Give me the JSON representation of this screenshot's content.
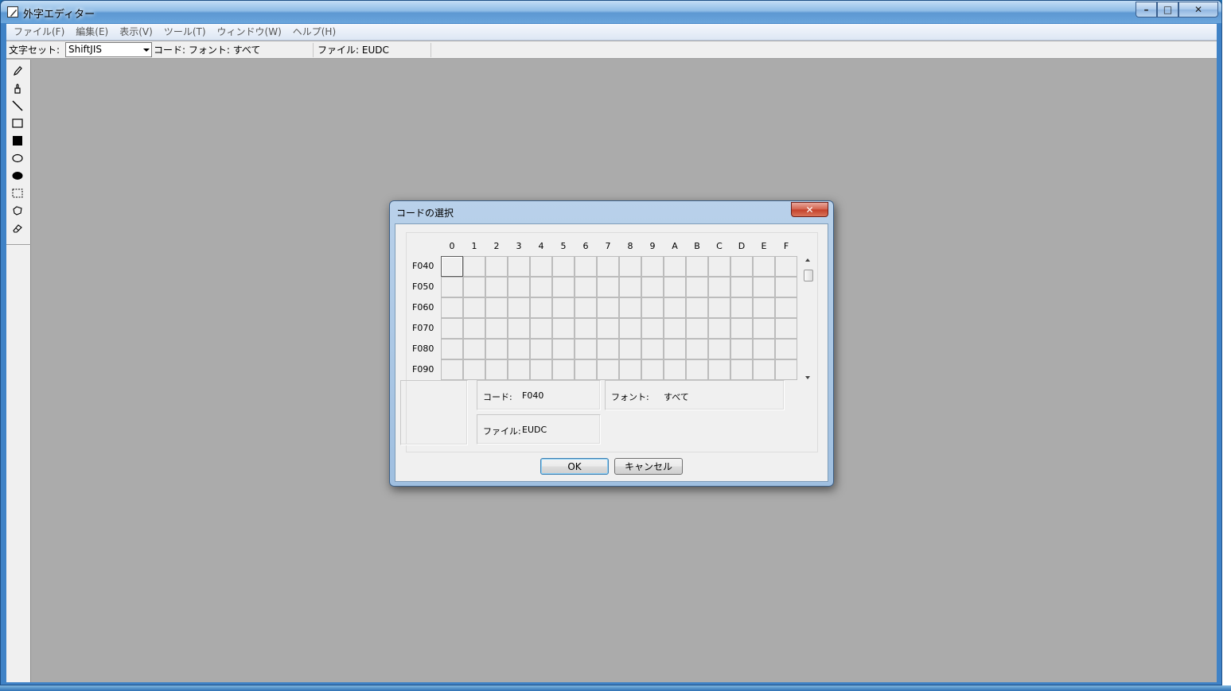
{
  "window": {
    "title": "外字エディター",
    "buttons": {
      "minimize": "–",
      "maximize": "□",
      "close": "✕"
    }
  },
  "menu": {
    "items": [
      {
        "label": "ファイル(F)"
      },
      {
        "label": "編集(E)"
      },
      {
        "label": "表示(V)"
      },
      {
        "label": "ツール(T)"
      },
      {
        "label": "ウィンドウ(W)"
      },
      {
        "label": "ヘルプ(H)"
      }
    ]
  },
  "statusbar": {
    "charset_label": "文字セット:",
    "charset_value": "ShiftJIS",
    "code_status": "コード:  フォント: すべて",
    "file_status": "ファイル: EUDC"
  },
  "toolbox": {
    "tools": [
      "pencil-icon",
      "brush-icon",
      "line-icon",
      "hollow-rectangle-icon",
      "filled-rectangle-icon",
      "hollow-ellipse-icon",
      "filled-ellipse-icon",
      "rectangular-selection-icon",
      "freeform-selection-icon",
      "eraser-icon"
    ]
  },
  "dialog": {
    "title": "コードの選択",
    "close": "✕",
    "columns": [
      "0",
      "1",
      "2",
      "3",
      "4",
      "5",
      "6",
      "7",
      "8",
      "9",
      "A",
      "B",
      "C",
      "D",
      "E",
      "F"
    ],
    "rows": [
      "F040",
      "F050",
      "F060",
      "F070",
      "F080",
      "F090"
    ],
    "selected_code": "F040",
    "code_label": "コード:",
    "code_value": "F040",
    "font_label": "フォント:",
    "font_value": "すべて",
    "file_label": "ファイル:",
    "file_value": "EUDC",
    "ok_label": "OK",
    "cancel_label": "キャンセル"
  }
}
